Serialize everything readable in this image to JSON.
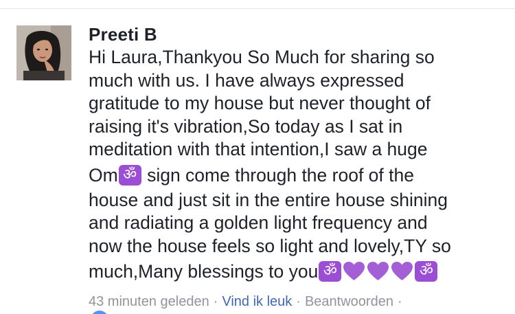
{
  "comment": {
    "author": "Preeti B",
    "lines": [
      "Hi Laura,Thankyou So Much for sharing so",
      "much with us. I have always expressed",
      "gratitude to my house but never thought of",
      "raising it's vibration,So today as I sat in",
      "meditation with that intention,I saw a huge",
      "sign come through the roof of the",
      "house and just sit in the entire  house shining",
      "and radiating a  golden light frequency and",
      "now the house feels so light and lovely,TY so",
      "much,Many blessings to you"
    ],
    "line6_prefix": "Om",
    "emoji": {
      "om": "om-symbol",
      "heart": "purple-heart",
      "om_color": "#9b4dd3",
      "heart_color": "#a55fd6"
    }
  },
  "meta": {
    "timestamp": "43 minuten geleden",
    "like_label": "Vind ik leuk",
    "reply_label": "Beantwoorden",
    "separator": "·",
    "link_color": "#4267b2",
    "meta_color": "#90949c"
  }
}
